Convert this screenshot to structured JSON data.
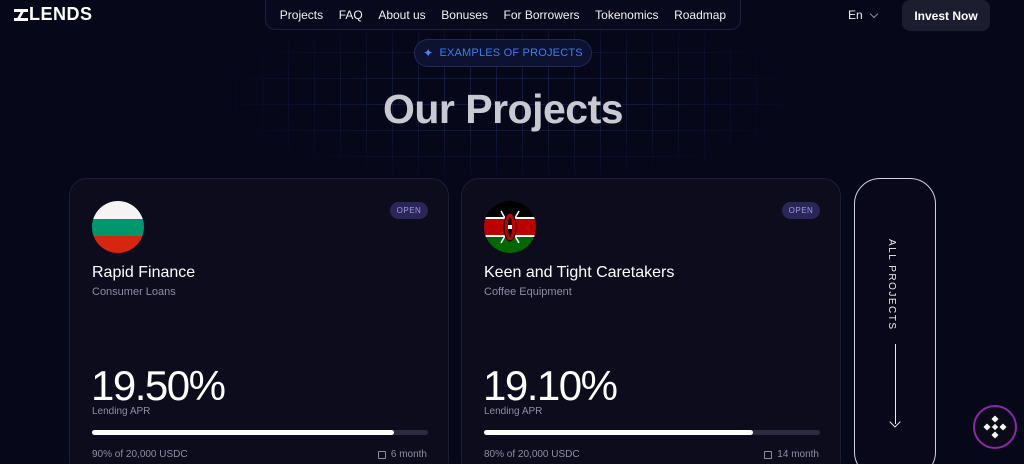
{
  "logo": {
    "text": "LENDS",
    "icon": "z-logo-icon"
  },
  "nav": {
    "items": [
      {
        "label": "Projects"
      },
      {
        "label": "FAQ"
      },
      {
        "label": "About us"
      },
      {
        "label": "Bonuses"
      },
      {
        "label": "For Borrowers"
      },
      {
        "label": "Tokenomics"
      },
      {
        "label": "Roadmap"
      }
    ]
  },
  "language": {
    "label": "En",
    "icon": "chevron-down-icon"
  },
  "header": {
    "invest_label": "Invest Now"
  },
  "badge": {
    "label": "EXAMPLES OF PROJECTS",
    "icon": "sparkle-icon"
  },
  "section": {
    "title": "Our Projects"
  },
  "projects": [
    {
      "name": "Rapid Finance",
      "category": "Consumer Loans",
      "status": "OPEN",
      "apr": "19.50%",
      "apr_label": "Lending APR",
      "progress_percent": 90,
      "funded": "90% of 20,000 USDC",
      "term": "6 month",
      "flag": "bulgaria-flag-icon"
    },
    {
      "name": "Keen and Tight Caretakers",
      "category": "Coffee Equipment",
      "status": "OPEN",
      "apr": "19.10%",
      "apr_label": "Lending APR",
      "progress_percent": 80,
      "funded": "80% of 20,000 USDC",
      "term": "14 month",
      "flag": "kenya-flag-icon"
    }
  ],
  "all_projects": {
    "label": "ALL PROJECTS",
    "icon": "arrow-down-icon"
  },
  "floating": {
    "icon": "binance-icon"
  },
  "colors": {
    "background": "#07071a",
    "accent_blue": "#3f7bf0",
    "status_badge": "#2a2657",
    "fab_ring": "#8a2aa8"
  }
}
